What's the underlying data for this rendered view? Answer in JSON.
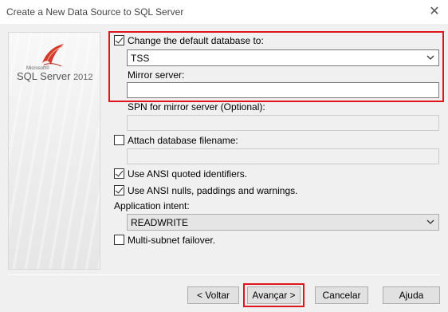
{
  "window": {
    "title": "Create a New Data Source to SQL Server",
    "close_glyph": "✕"
  },
  "logo": {
    "small_text": "Microsoft®",
    "main_text": "SQL Server",
    "year": "2012"
  },
  "options": {
    "change_db_label": "Change the default database to:",
    "change_db_checked": true,
    "database_value": "TSS",
    "mirror_label": "Mirror server:",
    "mirror_value": "",
    "spn_label": "SPN for mirror server (Optional):",
    "spn_value": "",
    "attach_label": "Attach database filename:",
    "attach_checked": false,
    "attach_value": "",
    "ansi_quoted_label": "Use ANSI quoted identifiers.",
    "ansi_quoted_checked": true,
    "ansi_nulls_label": "Use ANSI nulls, paddings and warnings.",
    "ansi_nulls_checked": true,
    "intent_label": "Application intent:",
    "intent_value": "READWRITE",
    "multisubnet_label": "Multi-subnet failover.",
    "multisubnet_checked": false
  },
  "buttons": {
    "back": "< Voltar",
    "next": "Avançar >",
    "cancel": "Cancelar",
    "help": "Ajuda"
  },
  "colors": {
    "highlight": "#e0141c"
  }
}
